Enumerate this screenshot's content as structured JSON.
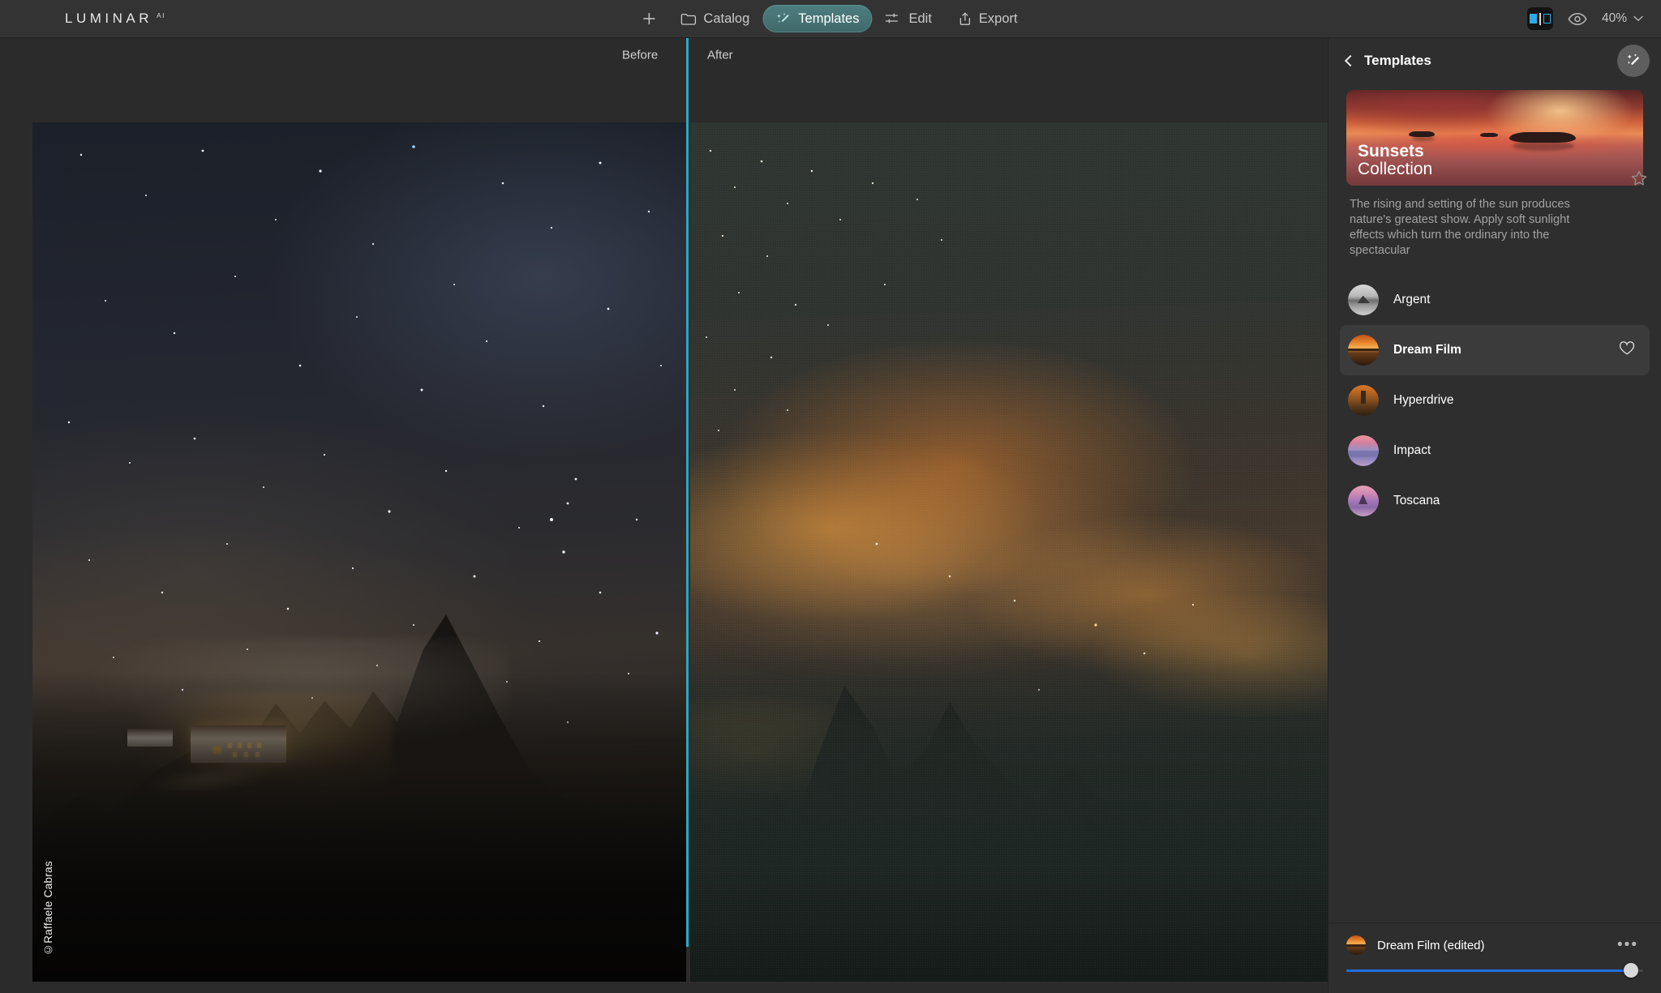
{
  "app": {
    "logo": "LUMINAR",
    "logo_superscript": "AI"
  },
  "toolbar": {
    "add_label": "+",
    "catalog_label": "Catalog",
    "templates_label": "Templates",
    "edit_label": "Edit",
    "export_label": "Export",
    "zoom_level": "40%",
    "accent_color": "#4e7e80",
    "compare_icon_color": "#2fa9e0"
  },
  "canvas": {
    "before_label": "Before",
    "after_label": "After",
    "photo_credit": "©Raffaele Cabras",
    "divider_color": "#2ba8c4"
  },
  "panel": {
    "title": "Templates",
    "collection": {
      "name_bold": "Sunsets",
      "name_regular": "Collection",
      "description": "The rising and setting of the sun produces nature's greatest show. Apply soft sunlight effects which turn the ordinary into the spectacular"
    },
    "templates": [
      {
        "name": "Argent",
        "thumb": "th-argent",
        "selected": false,
        "favorite": false
      },
      {
        "name": "Dream Film",
        "thumb": "th-dream",
        "selected": true,
        "favorite": true
      },
      {
        "name": "Hyperdrive",
        "thumb": "th-hyper",
        "selected": false,
        "favorite": false
      },
      {
        "name": "Impact",
        "thumb": "th-impact",
        "selected": false,
        "favorite": false
      },
      {
        "name": "Toscana",
        "thumb": "th-toscana",
        "selected": false,
        "favorite": false
      }
    ]
  },
  "bottom_bar": {
    "applied_template": "Dream Film (edited)",
    "more_label": "•••",
    "slider_percent": 96,
    "slider_color": "#1f6fe0"
  }
}
